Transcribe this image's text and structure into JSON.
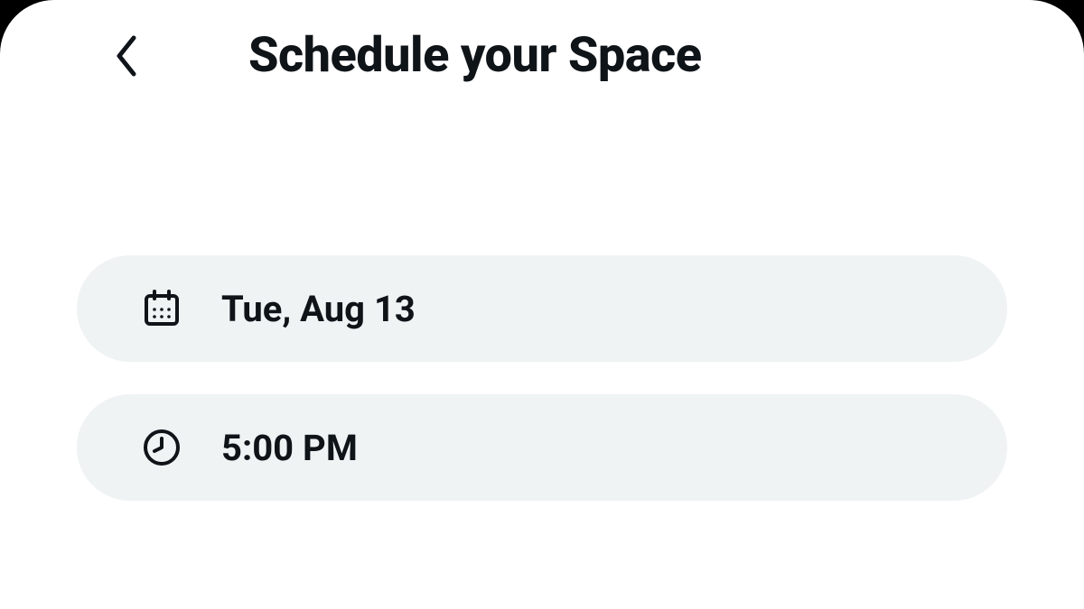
{
  "header": {
    "title": "Schedule your Space"
  },
  "fields": {
    "date": {
      "value": "Tue, Aug 13",
      "icon": "calendar-icon"
    },
    "time": {
      "value": "5:00 PM",
      "icon": "clock-icon"
    }
  }
}
